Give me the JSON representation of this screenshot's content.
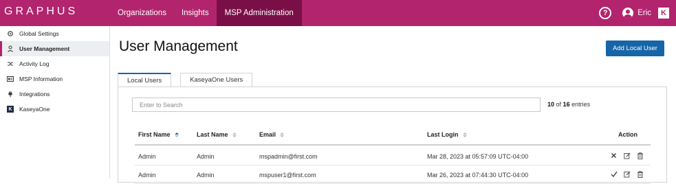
{
  "app": {
    "logo_text": "GRAPHUS"
  },
  "topnav": {
    "items": [
      {
        "label": "Organizations"
      },
      {
        "label": "Insights"
      },
      {
        "label": "MSP Administration"
      }
    ],
    "active": "MSP Administration",
    "user_name": "Eric",
    "kaseya_badge": "K",
    "help_glyph": "?"
  },
  "sidebar": {
    "items": [
      {
        "label": "Global Settings",
        "icon": "gear-icon"
      },
      {
        "label": "User Management",
        "icon": "user-icon"
      },
      {
        "label": "Activity Log",
        "icon": "shuffle-icon"
      },
      {
        "label": "MSP Information",
        "icon": "id-card-icon"
      },
      {
        "label": "Integrations",
        "icon": "plug-icon"
      },
      {
        "label": "KaseyaOne",
        "icon": "kaseya-icon"
      }
    ],
    "active": "User Management"
  },
  "main": {
    "title": "User Management",
    "add_button": "Add Local User",
    "tabs": [
      {
        "label": "Local Users"
      },
      {
        "label": "KaseyaOne Users"
      }
    ],
    "active_tab": "Local Users",
    "search": {
      "placeholder": "Enter to Search",
      "value": ""
    },
    "entries": {
      "shown": "10",
      "of_label": "of",
      "total": "16",
      "suffix": "entries"
    },
    "table": {
      "columns": [
        {
          "label": "First Name",
          "sort": "asc"
        },
        {
          "label": "Last Name",
          "sort": "none"
        },
        {
          "label": "Email",
          "sort": "none"
        },
        {
          "label": "Last Login",
          "sort": "none"
        },
        {
          "label": "Action",
          "sort": ""
        }
      ],
      "rows": [
        {
          "first": "Admin",
          "last": "Admin",
          "email": "mspadmin@first.com",
          "last_login": "Mar 28, 2023 at 05:57:09 UTC-04:00",
          "status_icon": "x-icon"
        },
        {
          "first": "Admin",
          "last": "Admin",
          "email": "mspuser1@first.com",
          "last_login": "Mar 26, 2023 at 07:44:30 UTC-04:00",
          "status_icon": "check-icon"
        }
      ]
    }
  },
  "colors": {
    "brand": "#b2246e",
    "brand_dark": "#7a0f47",
    "primary": "#1565a8"
  }
}
